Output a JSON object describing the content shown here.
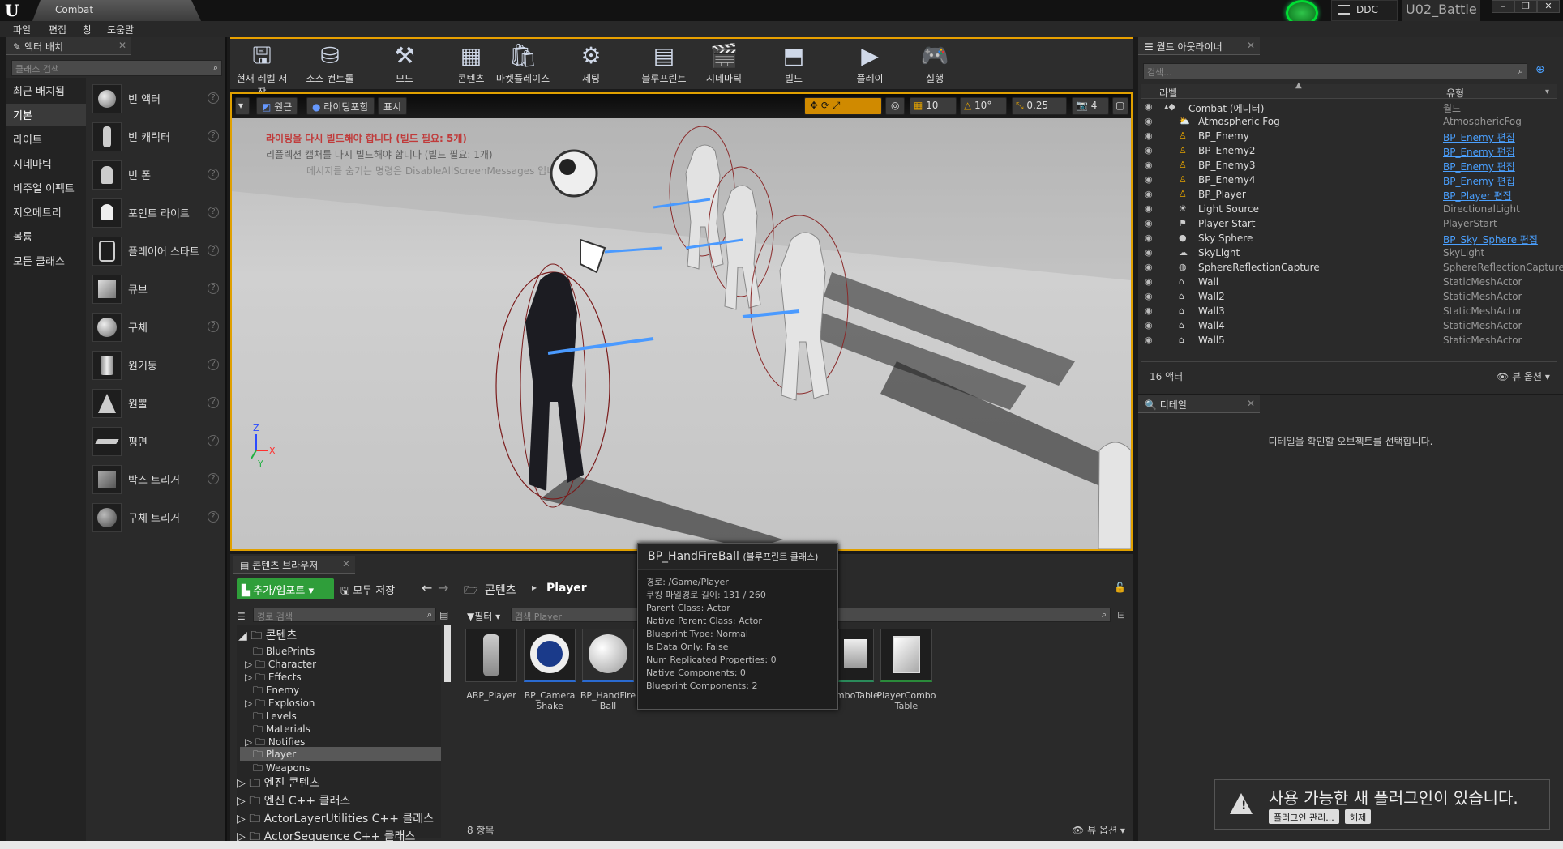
{
  "window": {
    "tab_title": "Combat",
    "ddc_label": "DDC",
    "project_name": "U02_Battle",
    "controls": [
      "‒",
      "❐",
      "✕"
    ]
  },
  "menubar": [
    "파일",
    "편집",
    "창",
    "도움말"
  ],
  "place_actors": {
    "tab_label": "액터 배치",
    "search_placeholder": "클래스 검색",
    "categories": [
      "최근 배치됨",
      "기본",
      "라이트",
      "시네마틱",
      "비주얼 이펙트",
      "지오메트리",
      "볼륨",
      "모든 클래스"
    ],
    "selected_category": "기본",
    "items": [
      "빈 액터",
      "빈 캐릭터",
      "빈 폰",
      "포인트 라이트",
      "플레이어 스타트",
      "큐브",
      "구체",
      "원기둥",
      "원뿔",
      "평면",
      "박스 트리거",
      "구체 트리거"
    ]
  },
  "toolbar": {
    "buttons": [
      "현재 레벨 저장",
      "소스 컨트롤",
      "모드",
      "콘텐츠",
      "마켓플레이스",
      "세팅",
      "블루프린트",
      "시네마틱",
      "빌드",
      "플레이",
      "실행"
    ]
  },
  "viewport": {
    "perspective_label": "원근",
    "lighting_label": "라이팅포함",
    "show_label": "표시",
    "grid_snap": "10",
    "rotation_snap": "10°",
    "scale_snap": "0.25",
    "camera_speed": "4",
    "messages": [
      "라이팅을 다시 빌드해야 합니다 (빌드 필요: 5개)",
      "리플렉션 캡처를 다시 빌드해야 합니다 (빌드 필요: 1개)",
      "메시지를 숨기는 명령은 DisableAllScreenMessages 입니다"
    ],
    "axis_labels": [
      "Z",
      "X",
      "Y"
    ]
  },
  "outliner": {
    "tab_label": "월드 아웃라이너",
    "search_placeholder": "검색...",
    "col_label": "라벨",
    "col_type": "유형",
    "rows": [
      {
        "name": "Combat (에디터)",
        "type": "월드",
        "link": false
      },
      {
        "name": "Atmospheric Fog",
        "type": "AtmosphericFog",
        "link": false
      },
      {
        "name": "BP_Enemy",
        "type": "BP_Enemy 편집",
        "link": true
      },
      {
        "name": "BP_Enemy2",
        "type": "BP_Enemy 편집",
        "link": true
      },
      {
        "name": "BP_Enemy3",
        "type": "BP_Enemy 편집",
        "link": true
      },
      {
        "name": "BP_Enemy4",
        "type": "BP_Enemy 편집",
        "link": true
      },
      {
        "name": "BP_Player",
        "type": "BP_Player 편집",
        "link": true
      },
      {
        "name": "Light Source",
        "type": "DirectionalLight",
        "link": false
      },
      {
        "name": "Player Start",
        "type": "PlayerStart",
        "link": false
      },
      {
        "name": "Sky Sphere",
        "type": "BP_Sky_Sphere 편집",
        "link": true
      },
      {
        "name": "SkyLight",
        "type": "SkyLight",
        "link": false
      },
      {
        "name": "SphereReflectionCapture",
        "type": "SphereReflectionCapture",
        "link": false
      },
      {
        "name": "Wall",
        "type": "StaticMeshActor",
        "link": false
      },
      {
        "name": "Wall2",
        "type": "StaticMeshActor",
        "link": false
      },
      {
        "name": "Wall3",
        "type": "StaticMeshActor",
        "link": false
      },
      {
        "name": "Wall4",
        "type": "StaticMeshActor",
        "link": false
      },
      {
        "name": "Wall5",
        "type": "StaticMeshActor",
        "link": false
      }
    ],
    "actor_count": "16 액터",
    "view_options": "뷰 옵션"
  },
  "details": {
    "tab_label": "디테일",
    "empty_message": "디테일을 확인할 오브젝트를 선택합니다."
  },
  "content_browser": {
    "tab_label": "콘텐츠 브라우저",
    "add_import": "추가/임포트",
    "save_all": "모두 저장",
    "crumb_root": "콘텐츠",
    "crumb_current": "Player",
    "path_search_placeholder": "경로 검색",
    "filter_label": "필터",
    "asset_search_placeholder": "검색 Player",
    "tree_root": "콘텐츠",
    "folders": [
      "BluePrints",
      "Character",
      "Effects",
      "Enemy",
      "Explosion",
      "Levels",
      "Materials",
      "Notifies",
      "Player",
      "Weapons"
    ],
    "selected_folder": "Player",
    "bottom_roots": [
      "엔진 콘텐츠",
      "엔진 C++ 클래스",
      "ActorLayerUtilities C++ 클래스",
      "ActorSequence C++ 클래스"
    ],
    "assets": [
      {
        "line1": "ABP_Player",
        "line2": ""
      },
      {
        "line1": "BP_Camera",
        "line2": "Shake"
      },
      {
        "line1": "BP_HandFire",
        "line2": "Ball"
      },
      {
        "line1": "omboTable",
        "line2": ""
      },
      {
        "line1": "PlayerCombo",
        "line2": "Table"
      }
    ],
    "item_count": "8 항목",
    "view_options": "뷰 옵션"
  },
  "tooltip": {
    "title": "BP_HandFireBall",
    "subtitle": "(블루프린트 클래스)",
    "lines": [
      "경로: /Game/Player",
      "쿠킹 파일경로 길이: 131 / 260",
      "Parent Class: Actor",
      "Native Parent Class: Actor",
      "Blueprint Type: Normal",
      "Is Data Only: False",
      "Num Replicated Properties: 0",
      "Native Components: 0",
      "Blueprint Components: 2"
    ]
  },
  "notification": {
    "message": "사용 가능한 새 플러그인이 있습니다.",
    "manage": "플러그인 관리...",
    "dismiss": "해제"
  },
  "colors": {
    "accent": "#e0a000",
    "link": "#4aa0ff",
    "warning": "#cc0000",
    "add_button": "#2f9e3a"
  }
}
